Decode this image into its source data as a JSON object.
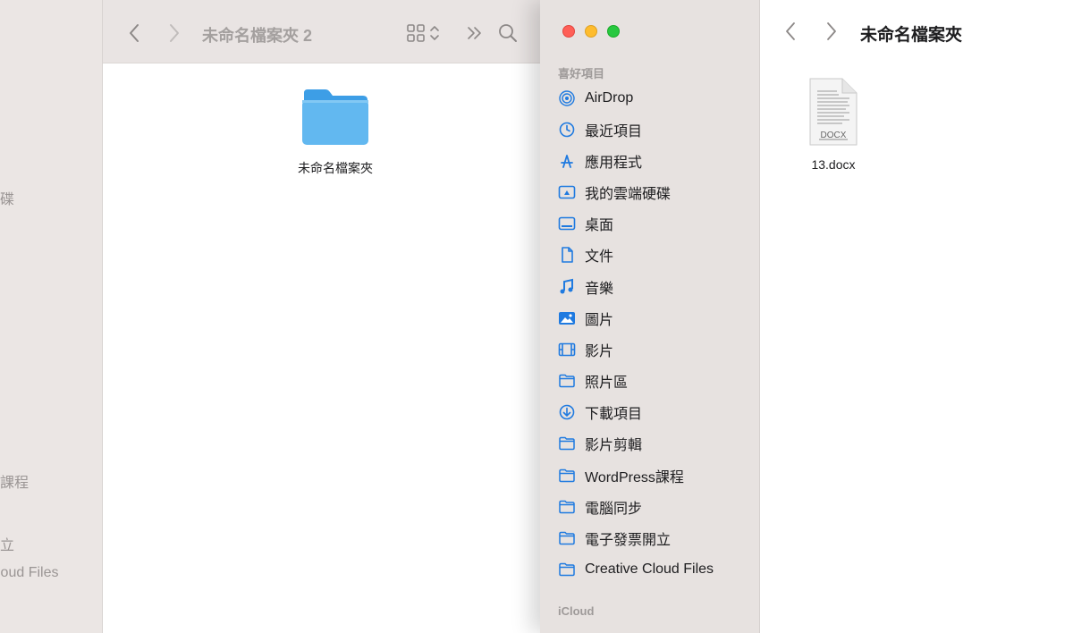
{
  "back_window": {
    "title": "未命名檔案夾 2",
    "sidebar_fragments": [
      "硬碟",
      "s課程",
      "開立",
      "loud Files"
    ],
    "folder": {
      "label": "未命名檔案夾"
    }
  },
  "front_window": {
    "title": "未命名檔案夾",
    "favorites_header": "喜好項目",
    "favorites": [
      {
        "label": "AirDrop",
        "icon": "airdrop-icon"
      },
      {
        "label": "最近項目",
        "icon": "clock-icon"
      },
      {
        "label": "應用程式",
        "icon": "applications-icon"
      },
      {
        "label": "我的雲端硬碟",
        "icon": "drive-folder-icon"
      },
      {
        "label": "桌面",
        "icon": "desktop-icon"
      },
      {
        "label": "文件",
        "icon": "document-icon"
      },
      {
        "label": "音樂",
        "icon": "music-note-icon"
      },
      {
        "label": "圖片",
        "icon": "photo-icon"
      },
      {
        "label": "影片",
        "icon": "film-icon"
      },
      {
        "label": "照片區",
        "icon": "folder-icon"
      },
      {
        "label": "下載項目",
        "icon": "download-icon"
      },
      {
        "label": "影片剪輯",
        "icon": "folder-icon"
      },
      {
        "label": "WordPress課程",
        "icon": "folder-icon"
      },
      {
        "label": "電腦同步",
        "icon": "folder-icon"
      },
      {
        "label": "電子發票開立",
        "icon": "folder-icon"
      },
      {
        "label": "Creative Cloud Files",
        "icon": "folder-icon"
      }
    ],
    "icloud_header": "iCloud",
    "file": {
      "label": "13.docx",
      "badge": "DOCX"
    }
  },
  "colors": {
    "accent": "#1f7ae0",
    "folder_blue": "#62b8f0",
    "sidebar_bg": "#e7e2e0"
  }
}
